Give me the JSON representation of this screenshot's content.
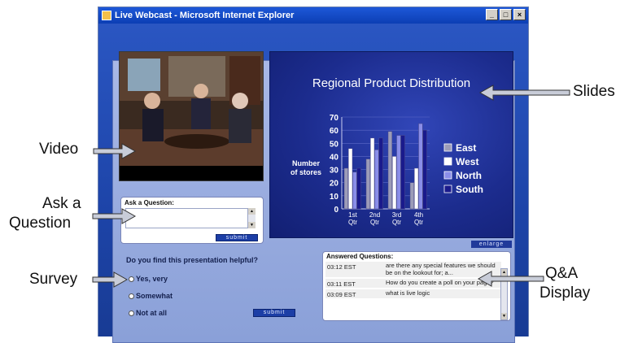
{
  "window": {
    "title": "Live Webcast - Microsoft Internet Explorer",
    "buttons": [
      "_",
      "□",
      "×"
    ]
  },
  "callouts": {
    "video": "Video",
    "ask_line1": "Ask a",
    "ask_line2": "Question",
    "survey": "Survey",
    "slides": "Slides",
    "qa_line1": "Q&A",
    "qa_line2": "Display"
  },
  "question": {
    "label": "Ask a Question:",
    "submit": "submit"
  },
  "slide": {
    "title": "Regional Product Distribution",
    "enlarge": "enlarge"
  },
  "survey": {
    "question": "Do you find this presentation helpful?",
    "options": [
      "Yes, very",
      "Somewhat",
      "Not at all"
    ],
    "submit": "submit"
  },
  "qa": {
    "label": "Answered Questions:",
    "rows": [
      {
        "time": "03:12 EST",
        "question": "are there any special features we should be on the lookout for; a..."
      },
      {
        "time": "03:11 EST",
        "question": "How do you create a poll on your page?"
      },
      {
        "time": "03:09 EST",
        "question": "what is live logic"
      }
    ]
  },
  "chart_data": {
    "type": "bar",
    "title": "",
    "ylabel": "Number of stores",
    "categories": [
      "1st Qtr",
      "2nd Qtr",
      "3rd Qtr",
      "4th Qtr"
    ],
    "ylim": [
      0,
      70
    ],
    "yticks": [
      0,
      10,
      20,
      30,
      40,
      50,
      60,
      70
    ],
    "series": [
      {
        "name": "East",
        "values": [
          31,
          38,
          59,
          20
        ],
        "color": "#9c9cb8"
      },
      {
        "name": "West",
        "values": [
          46,
          54,
          40,
          31
        ],
        "color": "#ffffff"
      },
      {
        "name": "North",
        "values": [
          28,
          45,
          56,
          65
        ],
        "color": "#8a8ee8"
      },
      {
        "name": "South",
        "values": [
          31,
          54,
          56,
          60
        ],
        "color": "#1a1a8c"
      }
    ],
    "legend_position": "right"
  },
  "colors": {
    "window_bg": "#0d2f8c",
    "slide_bg": "#1c2c8e",
    "submit_bg": "#1c3ea6"
  }
}
